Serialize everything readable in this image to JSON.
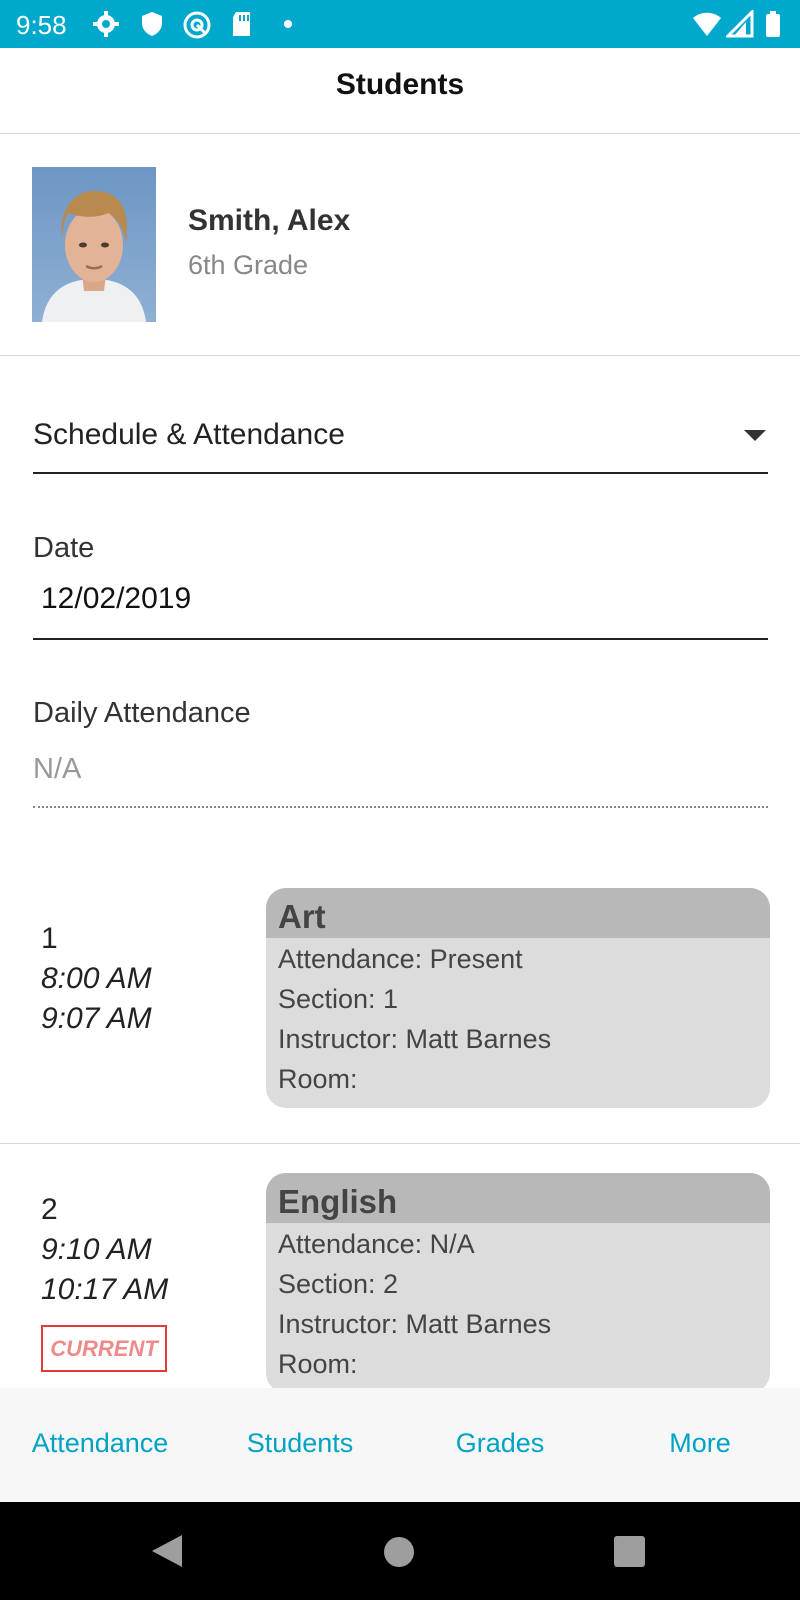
{
  "status_bar": {
    "time": "9:58",
    "icons": [
      "gear-icon",
      "shield-icon",
      "sync-icon",
      "sd-card-icon",
      "dot-icon",
      "wifi-icon",
      "signal-icon",
      "battery-icon"
    ],
    "color": "#00a9cc"
  },
  "app_bar": {
    "title": "Students"
  },
  "student": {
    "name": "Smith, Alex",
    "grade": "6th Grade"
  },
  "view_select": {
    "value": "Schedule & Attendance"
  },
  "date_field": {
    "label": "Date",
    "value": "12/02/2019"
  },
  "daily_attendance": {
    "label": "Daily Attendance",
    "value": "N/A"
  },
  "periods": [
    {
      "number": "1",
      "start": "8:00 AM",
      "end": "9:07 AM",
      "current": false,
      "class_name": "Art",
      "attendance": "Attendance: Present",
      "section": "Section: 1",
      "instructor": "Instructor: Matt Barnes",
      "room": "Room:"
    },
    {
      "number": "2",
      "start": "9:10 AM",
      "end": "10:17 AM",
      "current": true,
      "current_label": "CURRENT",
      "class_name": "English",
      "attendance": "Attendance: N/A",
      "section": "Section: 2",
      "instructor": "Instructor: Matt Barnes",
      "room": "Room:"
    }
  ],
  "tabs": [
    {
      "label": "Attendance"
    },
    {
      "label": "Students"
    },
    {
      "label": "Grades"
    },
    {
      "label": "More"
    }
  ],
  "colors": {
    "accent": "#00a3c4",
    "current_border": "#e53935",
    "card_header": "#b8b8b8",
    "card_body": "#dcdcdc"
  }
}
